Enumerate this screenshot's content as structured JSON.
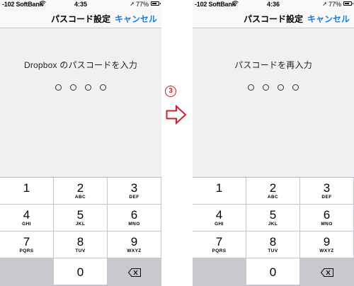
{
  "left_screen": {
    "status": {
      "carrier": "-102 SoftBank",
      "time": "4:35",
      "battery": "77%",
      "battery_level": 0.77
    },
    "nav": {
      "title": "パスコード設定",
      "cancel": "キャンセル"
    },
    "prompt": "Dropbox のパスコードを入力"
  },
  "right_screen": {
    "status": {
      "carrier": "-102 SoftBank",
      "time": "4:36",
      "battery": "77%",
      "battery_level": 0.77
    },
    "nav": {
      "title": "パスコード設定",
      "cancel": "キャンセル"
    },
    "prompt": "パスコードを再入力"
  },
  "keypad": {
    "keys": [
      {
        "num": "1",
        "letters": ""
      },
      {
        "num": "2",
        "letters": "ABC"
      },
      {
        "num": "3",
        "letters": "DEF"
      },
      {
        "num": "4",
        "letters": "GHI"
      },
      {
        "num": "5",
        "letters": "JKL"
      },
      {
        "num": "6",
        "letters": "MNO"
      },
      {
        "num": "7",
        "letters": "PQRS"
      },
      {
        "num": "8",
        "letters": "TUV"
      },
      {
        "num": "9",
        "letters": "WXYZ"
      },
      {
        "num": "0",
        "letters": ""
      }
    ]
  },
  "step": {
    "number": "3",
    "arrow_icon": "right-arrow-icon"
  },
  "colors": {
    "accent": "#1a7ce0",
    "step_red": "#d0202d",
    "keypad_bg": "#c7c9ce",
    "screen_bg": "#f0f0f3"
  }
}
